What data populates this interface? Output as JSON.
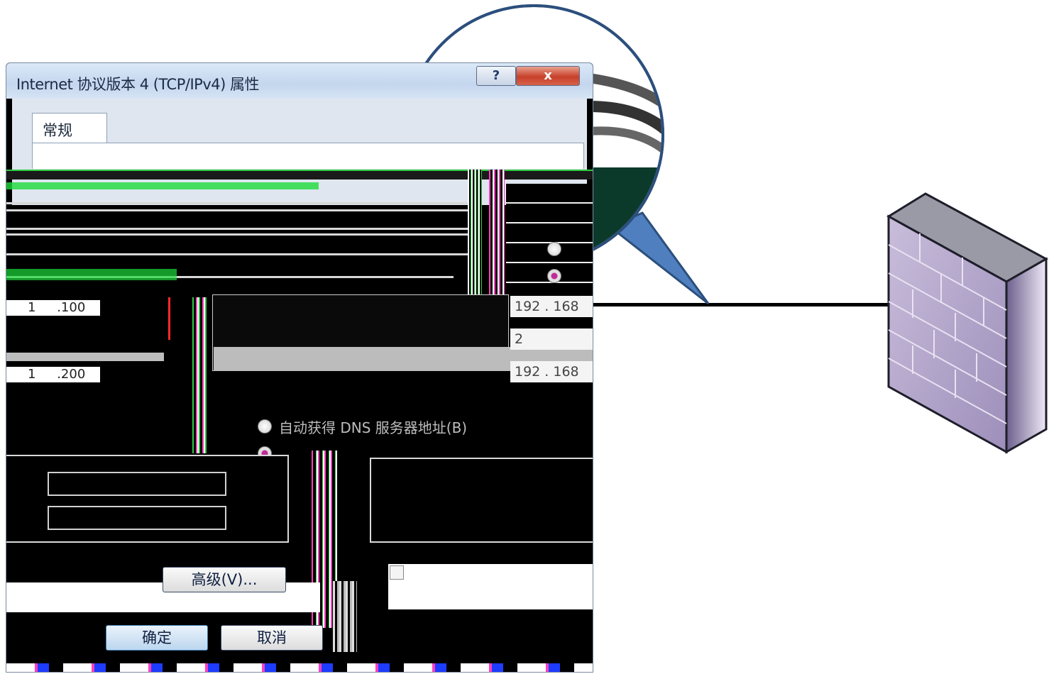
{
  "dialog": {
    "title": "Internet 协议版本 4 (TCP/IPv4) 属性",
    "help_label": "?",
    "close_label": "x",
    "tab_general": "常规",
    "ip_octet_1": "1",
    "ip_suffix_1": ".100",
    "ip_octet_2": "1",
    "ip_suffix_2": ".200",
    "right_ip_1": "192 . 168",
    "right_ip_2": "2",
    "right_ip_3": "192 . 168",
    "dns_auto_label": "自动获得 DNS 服务器地址(B)",
    "advanced_button": "高级(V)...",
    "ok_button": "确定",
    "cancel_button": "取消"
  },
  "colors": {
    "callout_fill": "#4f7fbf",
    "callout_stroke": "#2c4f7c",
    "firewall_front": "#b9aacd",
    "firewall_side": "#8a7aa8",
    "firewall_top": "#9a9aa6",
    "link_line": "#000000"
  },
  "icons": {
    "firewall": "firewall-icon",
    "callout": "magnifier-callout"
  }
}
